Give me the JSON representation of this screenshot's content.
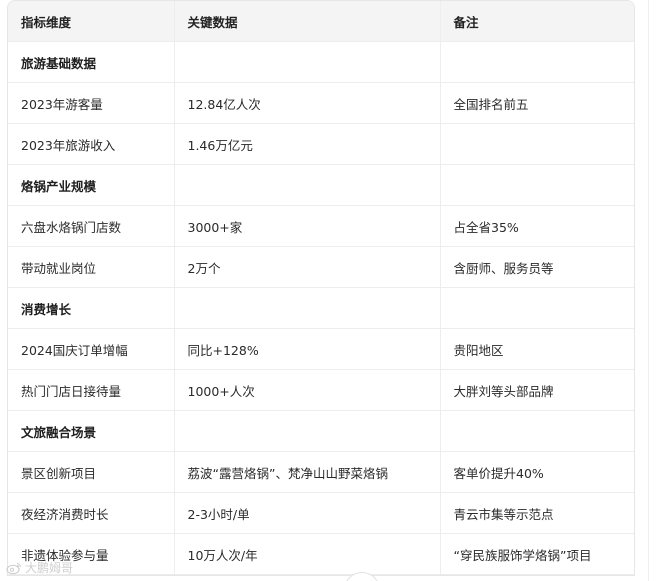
{
  "table": {
    "headers": [
      "指标维度",
      "关键数据",
      "备注"
    ],
    "rows": [
      {
        "type": "section",
        "cells": [
          "旅游基础数据",
          "",
          ""
        ]
      },
      {
        "type": "data",
        "cells": [
          "2023年游客量",
          "12.84亿人次",
          "全国排名前五"
        ]
      },
      {
        "type": "data",
        "cells": [
          "2023年旅游收入",
          "1.46万亿元",
          ""
        ]
      },
      {
        "type": "section",
        "cells": [
          "烙锅产业规模",
          "",
          ""
        ]
      },
      {
        "type": "data",
        "cells": [
          "六盘水烙锅门店数",
          "3000+家",
          "占全省35%"
        ]
      },
      {
        "type": "data",
        "cells": [
          "带动就业岗位",
          "2万个",
          "含厨师、服务员等"
        ]
      },
      {
        "type": "section",
        "cells": [
          "消费增长",
          "",
          ""
        ]
      },
      {
        "type": "data",
        "cells": [
          "2024国庆订单增幅",
          "同比+128%",
          "贵阳地区"
        ]
      },
      {
        "type": "data",
        "cells": [
          "热门门店日接待量",
          "1000+人次",
          "大胖刘等头部品牌"
        ]
      },
      {
        "type": "section",
        "cells": [
          "文旅融合场景",
          "",
          ""
        ]
      },
      {
        "type": "data",
        "cells": [
          "景区创新项目",
          "荔波“露营烙锅”、梵净山山野菜烙锅",
          "客单价提升40%"
        ]
      },
      {
        "type": "data",
        "cells": [
          "夜经济消费时长",
          "2-3小时/单",
          "青云市集等示范点"
        ]
      },
      {
        "type": "data",
        "cells": [
          "非遗体验参与量",
          "10万人次/年",
          "“穿民族服饰学烙锅”项目"
        ]
      }
    ]
  },
  "watermark": {
    "text": "大鹏姆哥",
    "icon": "weibo-logo-icon"
  }
}
